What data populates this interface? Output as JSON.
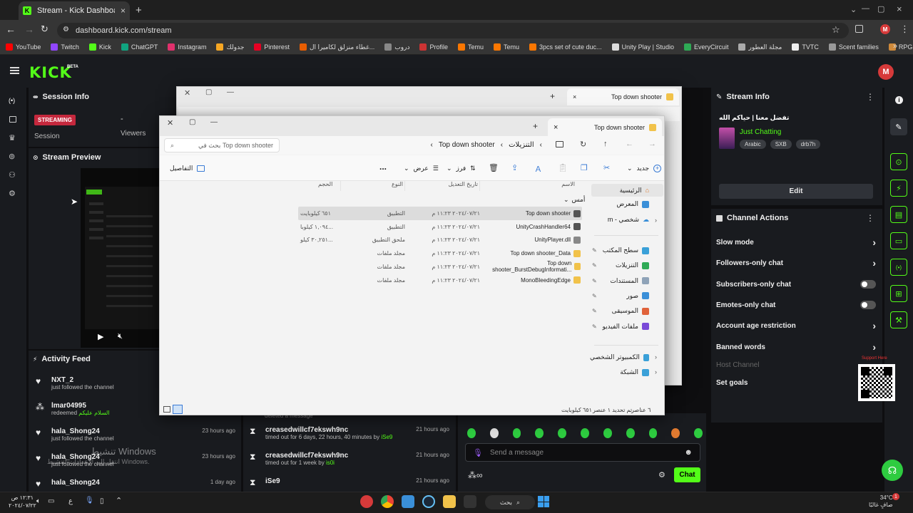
{
  "browser": {
    "tab_title": "Stream - Kick Dashboard",
    "url": "dashboard.kick.com/stream",
    "bookmarks": [
      {
        "label": "YouTube",
        "color": "#ff0000"
      },
      {
        "label": "Twitch",
        "color": "#9146ff"
      },
      {
        "label": "Kick",
        "color": "#53fc18"
      },
      {
        "label": "ChatGPT",
        "color": "#10a37f"
      },
      {
        "label": "Instagram",
        "color": "#e1306c"
      },
      {
        "label": "جدولك",
        "color": "#f5a623"
      },
      {
        "label": "Pinterest",
        "color": "#e60023"
      },
      {
        "label": "غطاء منزلق لكاميرا ال...",
        "color": "#e85d00"
      },
      {
        "label": "دروب",
        "color": "#888888"
      },
      {
        "label": "Profile",
        "color": "#cc3333"
      },
      {
        "label": "Temu",
        "color": "#fb7701"
      },
      {
        "label": "Temu",
        "color": "#fb7701"
      },
      {
        "label": "3pcs set of cute duc...",
        "color": "#fb7701"
      },
      {
        "label": "Unity Play | Studio",
        "color": "#dddddd"
      },
      {
        "label": "EveryCircuit",
        "color": "#2eaa55"
      },
      {
        "label": "مجلة العطور",
        "color": "#aaaaaa"
      },
      {
        "label": "TVTC",
        "color": "#eeeeee"
      },
      {
        "label": "Scent families",
        "color": "#999999"
      },
      {
        "label": "RPG Loot Vector Ico...",
        "color": "#d08a3a"
      }
    ]
  },
  "kick": {
    "logo": "KICK",
    "beta": "BETA",
    "avatar_letter": "M",
    "session_info": {
      "title": "Session Info",
      "status_badge": "STREAMING",
      "session_label": "Session",
      "viewers_value": "-",
      "viewers_label": "Viewers"
    },
    "stream_preview": {
      "title": "Stream Preview"
    },
    "activity_feed": {
      "title": "Activity Feed",
      "items": [
        {
          "name": "NXT_2",
          "sub": "just followed the channel",
          "time": ""
        },
        {
          "name": "lmar04995",
          "sub": "redeemed",
          "highlight": "السلام عليكم",
          "time": ""
        },
        {
          "name": "hala_Shong24",
          "sub": "just followed the channel",
          "time": "23 hours ago"
        },
        {
          "name": "hala_Shong24",
          "sub": "just followed the channel",
          "time": "23 hours ago"
        },
        {
          "name": "hala_Shong24",
          "sub": "",
          "time": "1 day ago"
        }
      ]
    },
    "mod_feed": {
      "top_partial": "deleted a message",
      "items": [
        {
          "name": "creasedwillcf7ekswh9nc",
          "sub_prefix": "timed out for 6 days, 22 hours, 40 minutes by",
          "by": "iSe9",
          "time": "21 hours ago"
        },
        {
          "name": "creasedwillcf7ekswh9nc",
          "sub_prefix": "timed out for 1 week by",
          "by": "is0i",
          "time": "21 hours ago"
        },
        {
          "name": "iSe9",
          "sub_prefix": "",
          "by": "",
          "time": "21 hours ago"
        }
      ]
    },
    "chat": {
      "placeholder": "Send a message",
      "send_label": "Chat"
    },
    "stream_info": {
      "title": "Stream Info",
      "stream_title": "تفضل معنا | حياكم الله",
      "category": "Just Chatting",
      "tags": [
        "Arabic",
        "SXB",
        "drb7h"
      ],
      "edit_label": "Edit"
    },
    "channel_actions": {
      "title": "Channel Actions",
      "items": [
        {
          "label": "Slow mode",
          "control": "chevron",
          "enabled": true
        },
        {
          "label": "Followers-only chat",
          "control": "chevron",
          "enabled": true
        },
        {
          "label": "Subscribers-only chat",
          "control": "toggle",
          "enabled": true
        },
        {
          "label": "Emotes-only chat",
          "control": "toggle",
          "enabled": true
        },
        {
          "label": "Account age restriction",
          "control": "chevron",
          "enabled": true
        },
        {
          "label": "Banned words",
          "control": "chevron",
          "enabled": true
        },
        {
          "label": "Host Channel",
          "control": "none",
          "enabled": false
        },
        {
          "label": "Set goals",
          "control": "none",
          "enabled": true
        }
      ]
    },
    "support_here": "Support Here"
  },
  "explorer_back": {
    "tab_title": "Top down shooter"
  },
  "explorer": {
    "tab_title": "Top down shooter",
    "search_placeholder": "بحث في Top down shooter",
    "breadcrumb": [
      "التنزيلات",
      "Top down shooter"
    ],
    "toolbar": {
      "new_label": "جديد",
      "sort_label": "فرز",
      "view_label": "عرض",
      "details_label": "التفاصيل",
      "more": "..."
    },
    "columns": {
      "name": "الاسم",
      "date": "تاريخ التعديل",
      "type": "النوع",
      "size": "الحجم"
    },
    "group_label": "أمس",
    "files": [
      {
        "name": "Top down shooter",
        "date": "٢٠٢٤/٠٧/٢١ ١١:٢٣ م",
        "type": "التطبيق",
        "size": "٦٥١ كيلوبايت",
        "icon_color": "#555555",
        "selected": true
      },
      {
        "name": "UnityCrashHandler64",
        "date": "٢٠٢٤/٠٧/٢١ ١١:٢٣ م",
        "type": "التطبيق",
        "size": "١,٠٩٤ كيلوبا...",
        "icon_color": "#555555",
        "selected": false
      },
      {
        "name": "UnityPlayer.dll",
        "date": "٢٠٢٤/٠٧/٢١ ١١:٢٣ م",
        "type": "ملحق التطبيق",
        "size": "٣٠,٢٥١ كيلو...",
        "icon_color": "#888888",
        "selected": false
      },
      {
        "name": "Top down shooter_Data",
        "date": "٢٠٢٤/٠٧/٢١ ١١:٢٣ م",
        "type": "مجلد ملفات",
        "size": "",
        "icon_color": "#f1c24a",
        "selected": false
      },
      {
        "name": "Top down shooter_BurstDebugInformati...",
        "date": "٢٠٢٤/٠٧/٢١ ١١:٢٣ م",
        "type": "مجلد ملفات",
        "size": "",
        "icon_color": "#f1c24a",
        "selected": false
      },
      {
        "name": "MonoBleedingEdge",
        "date": "٢٠٢٤/٠٧/٢١ ١١:٢٣ م",
        "type": "مجلد ملفات",
        "size": "",
        "icon_color": "#f1c24a",
        "selected": false
      }
    ],
    "nav": {
      "home": "الرئيسية",
      "gallery": "المعرض",
      "onedrive": "m - شخصي",
      "quick": [
        {
          "label": "سطح المكتب",
          "color": "#3aa0d8"
        },
        {
          "label": "التنزيلات",
          "color": "#2eaa55"
        },
        {
          "label": "المستندات",
          "color": "#8fa3b8"
        },
        {
          "label": "صور",
          "color": "#3a8fd8"
        },
        {
          "label": "الموسيقى",
          "color": "#e0623a"
        },
        {
          "label": "ملفات الفيديو",
          "color": "#7a4ad8"
        }
      ],
      "this_pc": "هذا الكمبيوتر الشخصي",
      "network": "الشبكة"
    },
    "status": {
      "count": "٦ عناصر",
      "selected": "تم تحديد ١ عنصر",
      "size": "٦٥١ كيلوبايت"
    }
  },
  "watermark": {
    "line1": "تنشيط Windows",
    "line2": "انتقل إلى الإعدادات لتنشيط Windows."
  },
  "taskbar": {
    "time": "١٢:٣١ ص",
    "date": "٢٠٢٤/٠٧/٢٢",
    "search_label": "بحث",
    "lang": "ع",
    "weather_temp": "34°C",
    "weather_desc": "صافٍ غالبًا",
    "notif_count": "1"
  }
}
